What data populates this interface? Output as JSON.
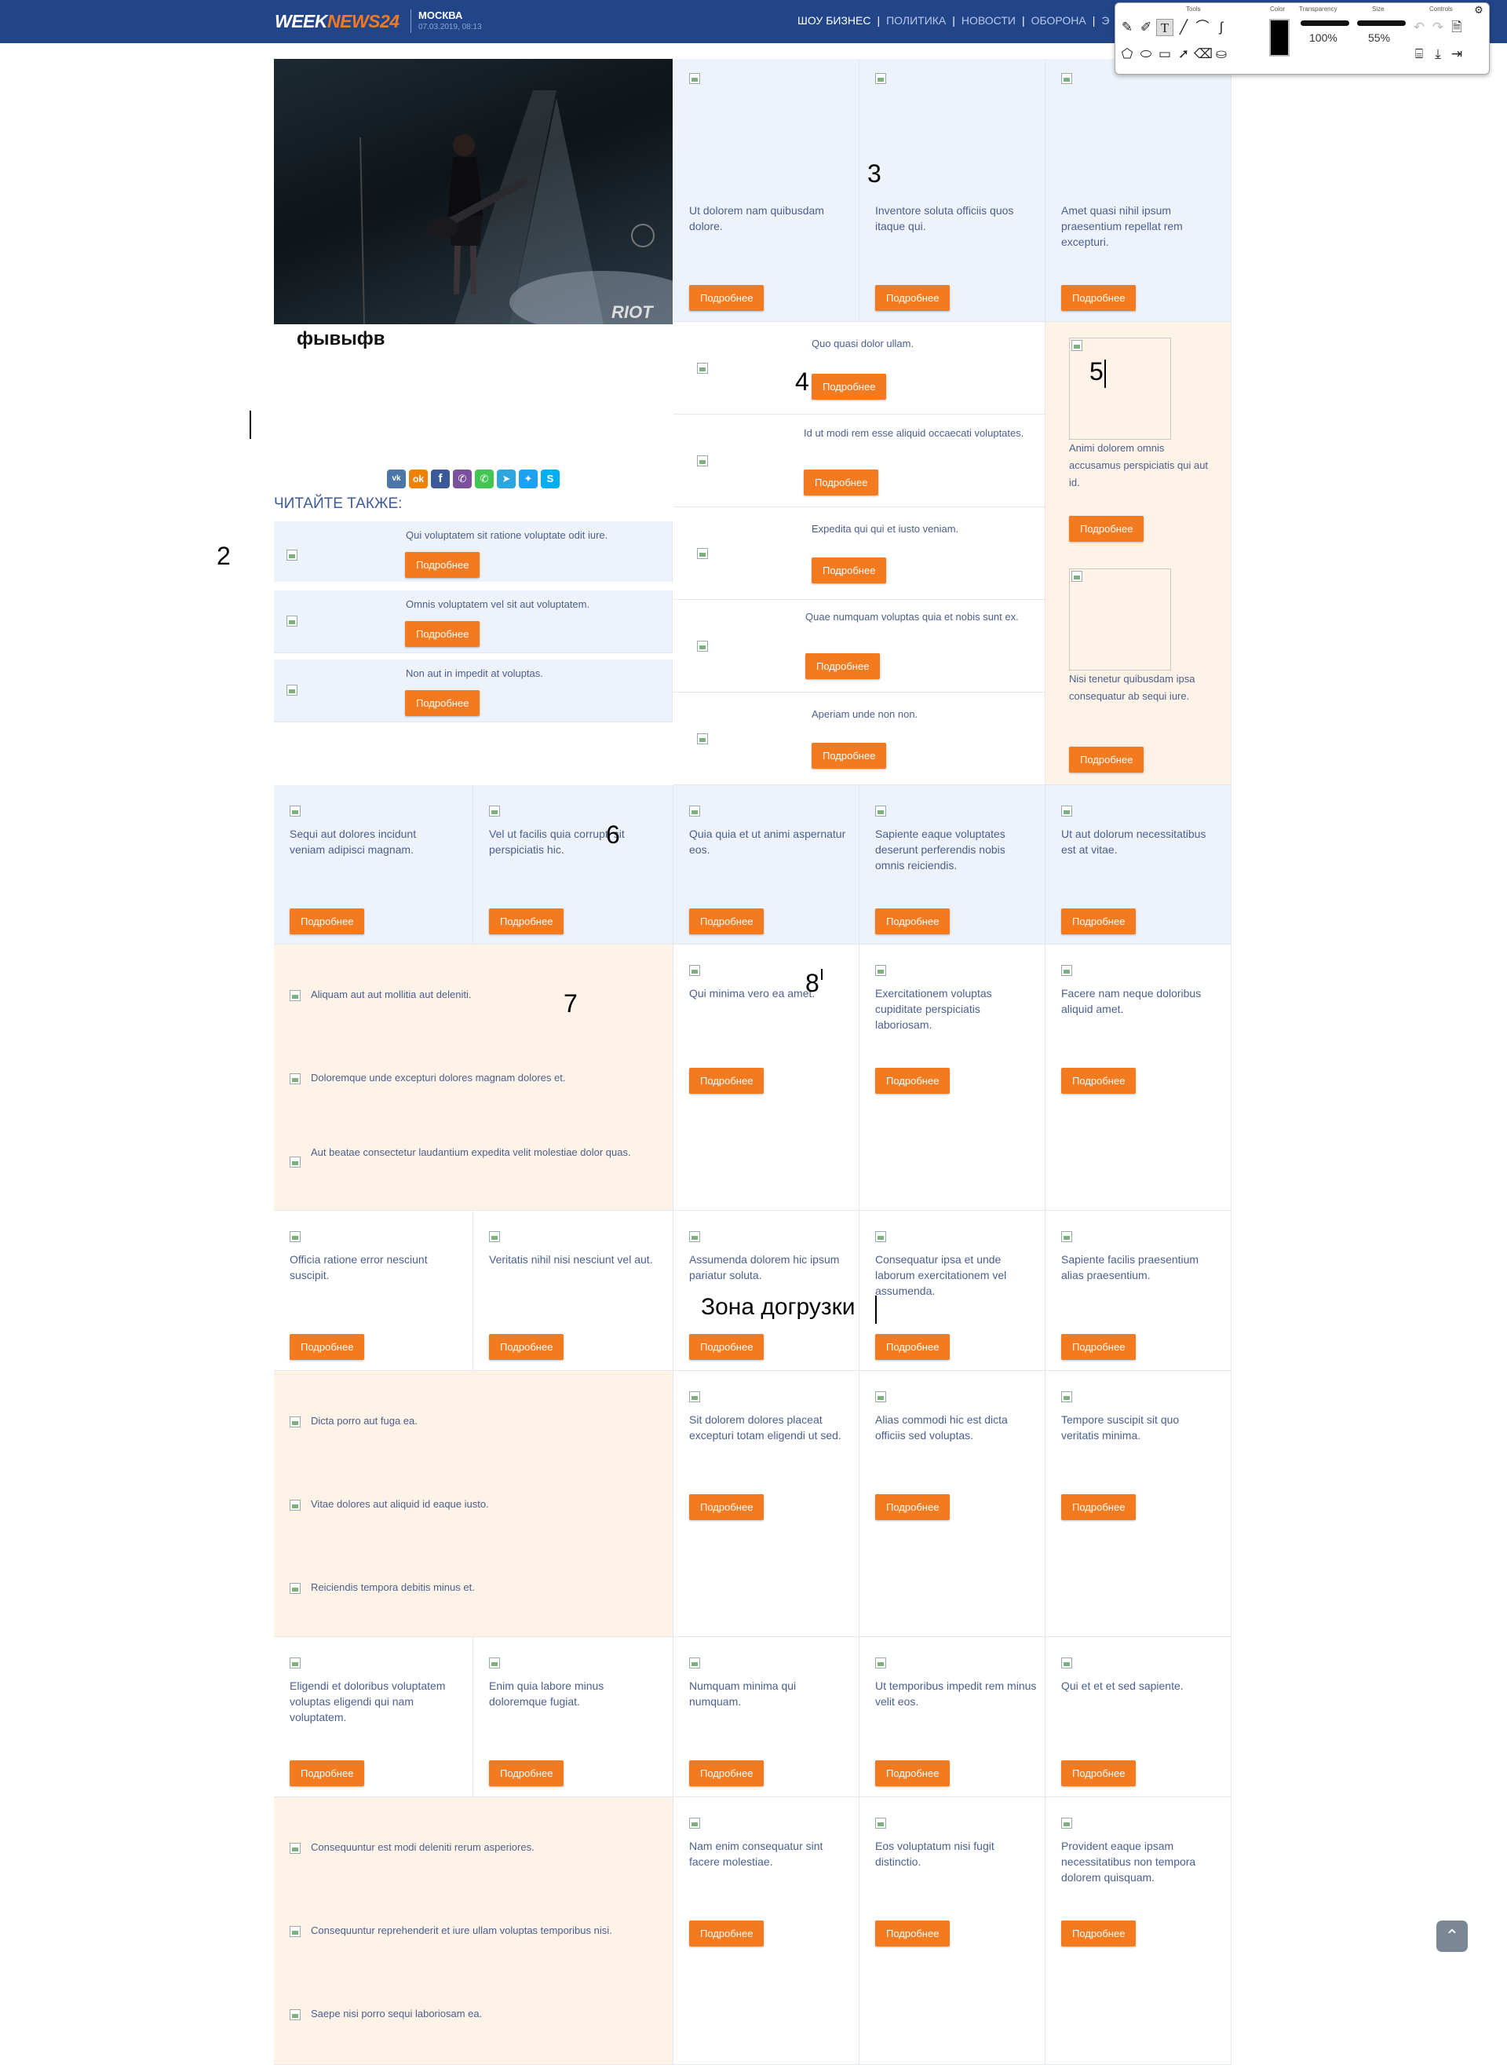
{
  "header": {
    "logo_week": "WEEK",
    "logo_news": "NEWS24",
    "city": "МОСКВА",
    "date": "07.03.2019, 08:13",
    "nav": [
      "ШОУ БИЗНЕС",
      "ПОЛИТИКА",
      "НОВОСТИ",
      "ОБОРОНА",
      "Э"
    ],
    "nav_separator": "|"
  },
  "toolbar": {
    "tools_label": "Tools",
    "color_label": "Color",
    "transparency_label": "Transparency",
    "transparency_value": "100%",
    "size_label": "Size",
    "size_value": "55%",
    "controls_label": "Controls"
  },
  "article": {
    "title": "фывыфв",
    "read_also": "ЧИТАЙТЕ ТАКЖЕ:",
    "read_also_items": [
      "Qui voluptatem sit ratione voluptate odit iure.",
      "Omnis voluptatem vel sit aut voluptatem.",
      "Non aut in impedit at voluptas."
    ]
  },
  "more_label": "Подробнее",
  "annotations": {
    "a2": "2",
    "a3": "3",
    "a4": "4",
    "a5": "5",
    "a6": "6",
    "a7": "7",
    "a8": "8",
    "zone": "Зона догрузки"
  },
  "row1": [
    "Ut dolorem nam quibusdam dolore.",
    "Inventore soluta officiis quos itaque qui.",
    "Amet quasi nihil ipsum praesentium repellat rem excepturi."
  ],
  "list_mid": [
    "Quo quasi dolor ullam.",
    "Id ut modi rem esse aliquid occaecati voluptates.",
    "Expedita qui qui et iusto veniam.",
    "Quae numquam voluptas quia et nobis sunt ex.",
    "Aperiam unde non non."
  ],
  "side_right": [
    "Animi dolorem omnis accusamus perspiciatis qui aut id.",
    "Nisi tenetur quibusdam ipsa consequatur ab sequi iure."
  ],
  "row3": [
    "Sequi aut dolores incidunt veniam adipisci magnam.",
    "Vel ut facilis quia corrupti sit perspiciatis hic.",
    "Quia quia et ut animi aspernatur eos.",
    "Sapiente eaque voluptates deserunt perferendis nobis omnis reiciendis.",
    "Ut aut dolorum necessitatibus est at vitae."
  ],
  "row4_list": [
    "Aliquam aut aut mollitia aut deleniti.",
    "Doloremque unde excepturi dolores magnam dolores et.",
    "Aut beatae consectetur laudantium expedita velit molestiae dolor quas."
  ],
  "row4": [
    "Qui minima vero ea amet.",
    "Exercitationem voluptas cupiditate perspiciatis laboriosam.",
    "Facere nam neque doloribus aliquid amet."
  ],
  "row5": [
    "Officia ratione error nesciunt suscipit.",
    "Veritatis nihil nisi nesciunt vel aut.",
    "Assumenda dolorem hic ipsum pariatur soluta.",
    "Consequatur ipsa et unde laborum exercitationem vel assumenda.",
    "Sapiente facilis praesentium alias praesentium."
  ],
  "row6_list": [
    "Dicta porro aut fuga ea.",
    "Vitae dolores aut aliquid id eaque iusto.",
    "Reiciendis tempora debitis minus et."
  ],
  "row6": [
    "Sit dolorem dolores placeat excepturi totam eligendi ut sed.",
    "Alias commodi hic est dicta officiis sed voluptas.",
    "Tempore suscipit sit quo veritatis minima."
  ],
  "row7": [
    "Eligendi et doloribus voluptatem voluptas eligendi qui nam voluptatem.",
    "Enim quia labore minus doloremque fugiat.",
    "Numquam minima qui numquam.",
    "Ut temporibus impedit rem minus velit eos.",
    "Qui et et et sed sapiente."
  ],
  "row8_list": [
    "Consequuntur est modi deleniti rerum asperiores.",
    "Consequuntur reprehenderit et iure ullam voluptas temporibus nisi.",
    "Saepe nisi porro sequi laboriosam ea."
  ],
  "row8": [
    "Nam enim consequatur sint facere molestiae.",
    "Eos voluptatum nisi fugit distinctio.",
    "Provident eaque ipsam necessitatibus non tempora dolorem quisquam."
  ]
}
